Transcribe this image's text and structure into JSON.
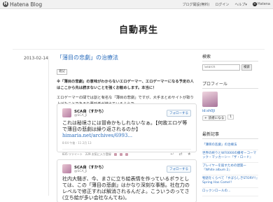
{
  "globalbar": {
    "logo_text": "Hatena Blog",
    "nav": [
      "ブログ開設(無料)",
      "ログイン",
      "ヘルプ▾"
    ],
    "hatena_label": "Hatena"
  },
  "blog": {
    "title": "自動再生"
  },
  "entry": {
    "date": "2013-02-14",
    "title": "「薄目の悲劇」の治療法",
    "category": "雑記",
    "para1": "※「薄目の悲劇」の意味がわからないエロゲーマー、エロゲーマーになる予定の人はここから先は読まないことを強くお勧めします。本当に！",
    "para2": "エロゲーマーの間では割と有名な「薄目の悲劇」ですが、大手まとめサイトが取り上げたことであまり蔓延者が増えているようで。"
  },
  "tweets": [
    {
      "name": "SCA自（すかち）",
      "handle": "@SCA_Ji",
      "follow": "フォローする",
      "body": "これは秘境さには冒命かもしれないなぁ。【何故エロゲ等で薄目の悲劇は繰り返されるのか】",
      "link": "himaria.net/archives/6993...",
      "meta": "8:04 午後 - 11 2月 13",
      "retweets": "835 リツイート",
      "favorites": "229 お気に入り登録"
    },
    {
      "name": "SCA自（すかち）",
      "handle": "@SCA_Ji",
      "follow": "フォローする",
      "body": "社内大騒ぎ、今、まさに立ち絵表情を作っているポラとしては、この「薄目の悲劇」はかなり深刻な事態。社在力のレベルで修正すれば解消されるんだよ。こういうのってさ(立ち絵が多い会社なんてね)。"
    }
  ],
  "sidebar": {
    "search_heading": "検索",
    "search_placeholder": "Search",
    "search_button": "検索",
    "profile_heading": "プロフィール",
    "profile_id": "id:sh0Ji",
    "reader_button": "読者になる",
    "reader_count": "1",
    "recent_heading": "最新記事",
    "recent": [
      "「薄目の悲劇」の治療法",
      "世界の終りとWF0000の備考ーコーマック・マッカーシー『ザ・ロード』",
      "プレイヤーを殺すための建築ー『White album 2』",
      "物語をくらべて『すばらしきSTORY!!』Spring Has Come!!",
      "ロックンロールの…"
    ]
  }
}
